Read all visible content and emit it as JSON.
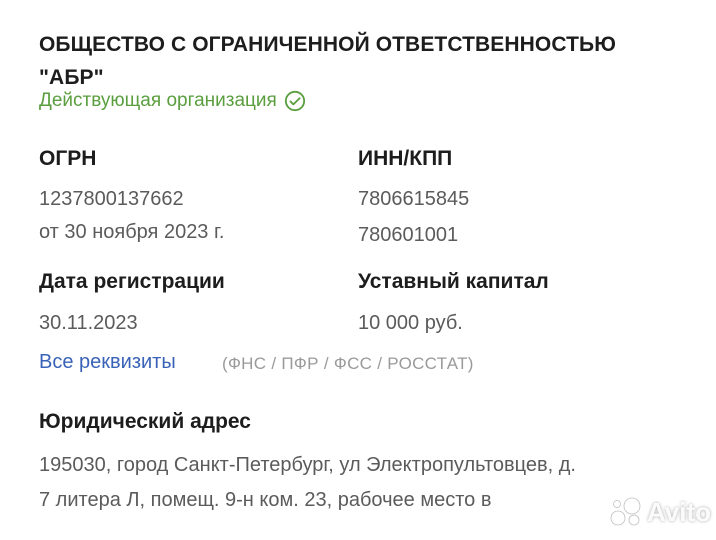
{
  "company": {
    "name_line1": "ОБЩЕСТВО С ОГРАНИЧЕННОЙ ОТВЕТСТВЕННОСТЬЮ",
    "name_line2": "\"АБР\"",
    "status": "Действующая организация",
    "status_color": "#5a9e3f"
  },
  "ogrn": {
    "label": "ОГРН",
    "number": "1237800137662",
    "date": "от 30 ноября 2023 г."
  },
  "inn_kpp": {
    "label": "ИНН/КПП",
    "inn": "7806615845",
    "kpp": "780601001"
  },
  "registration": {
    "label": "Дата регистрации",
    "date": "30.11.2023"
  },
  "capital": {
    "label": "Уставный капитал",
    "value": "10 000 руб."
  },
  "requisites": {
    "link_label": "Все реквизиты",
    "link_color": "#3a63b8",
    "sources": "(ФНС / ПФР / ФСС / РОССТАТ)"
  },
  "address": {
    "label": "Юридический адрес",
    "line1": "195030, город Санкт-Петербург, ул Электропультовцев, д.",
    "line2": "7 литера Л, помещ. 9-н ком. 23, рабочее место в"
  },
  "watermark": {
    "text": "Avito",
    "icon": "avito-logo-icon"
  }
}
